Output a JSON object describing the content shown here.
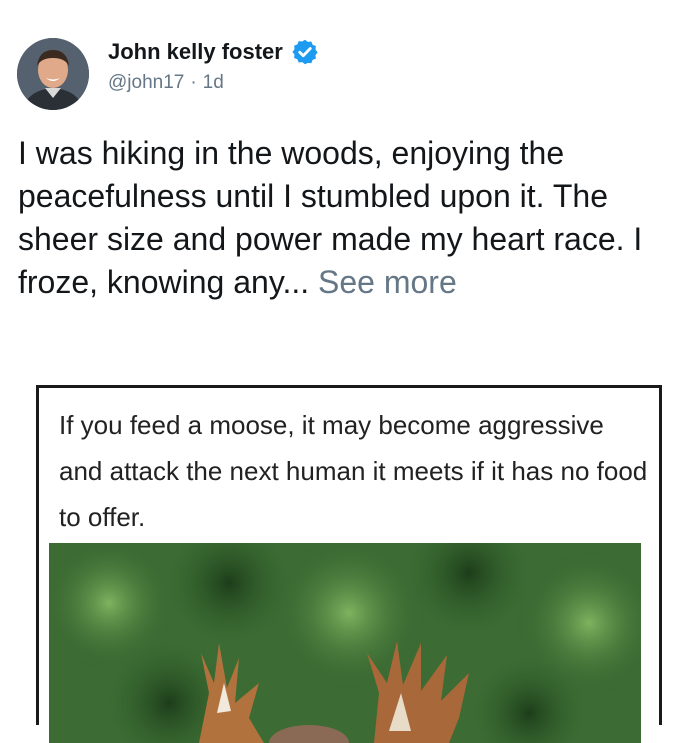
{
  "author": {
    "display_name": "John kelly foster",
    "handle": "@john17",
    "separator": "·",
    "timestamp": "1d",
    "verified_icon": "verified-badge-icon"
  },
  "tweet": {
    "text": "I was hiking in the woods, enjoying the peacefulness until I stumbled upon it. The sheer size and power made my heart race. I froze, knowing any...",
    "see_more": "See more"
  },
  "media": {
    "caption": "If you feed a moose, it may become aggressive and attack the next human it meets if it has no food to offer.",
    "photo_subject": "moose-photo"
  },
  "colors": {
    "verified_blue": "#1d9bf0",
    "secondary_text": "#657786",
    "primary_text": "#14171a"
  }
}
